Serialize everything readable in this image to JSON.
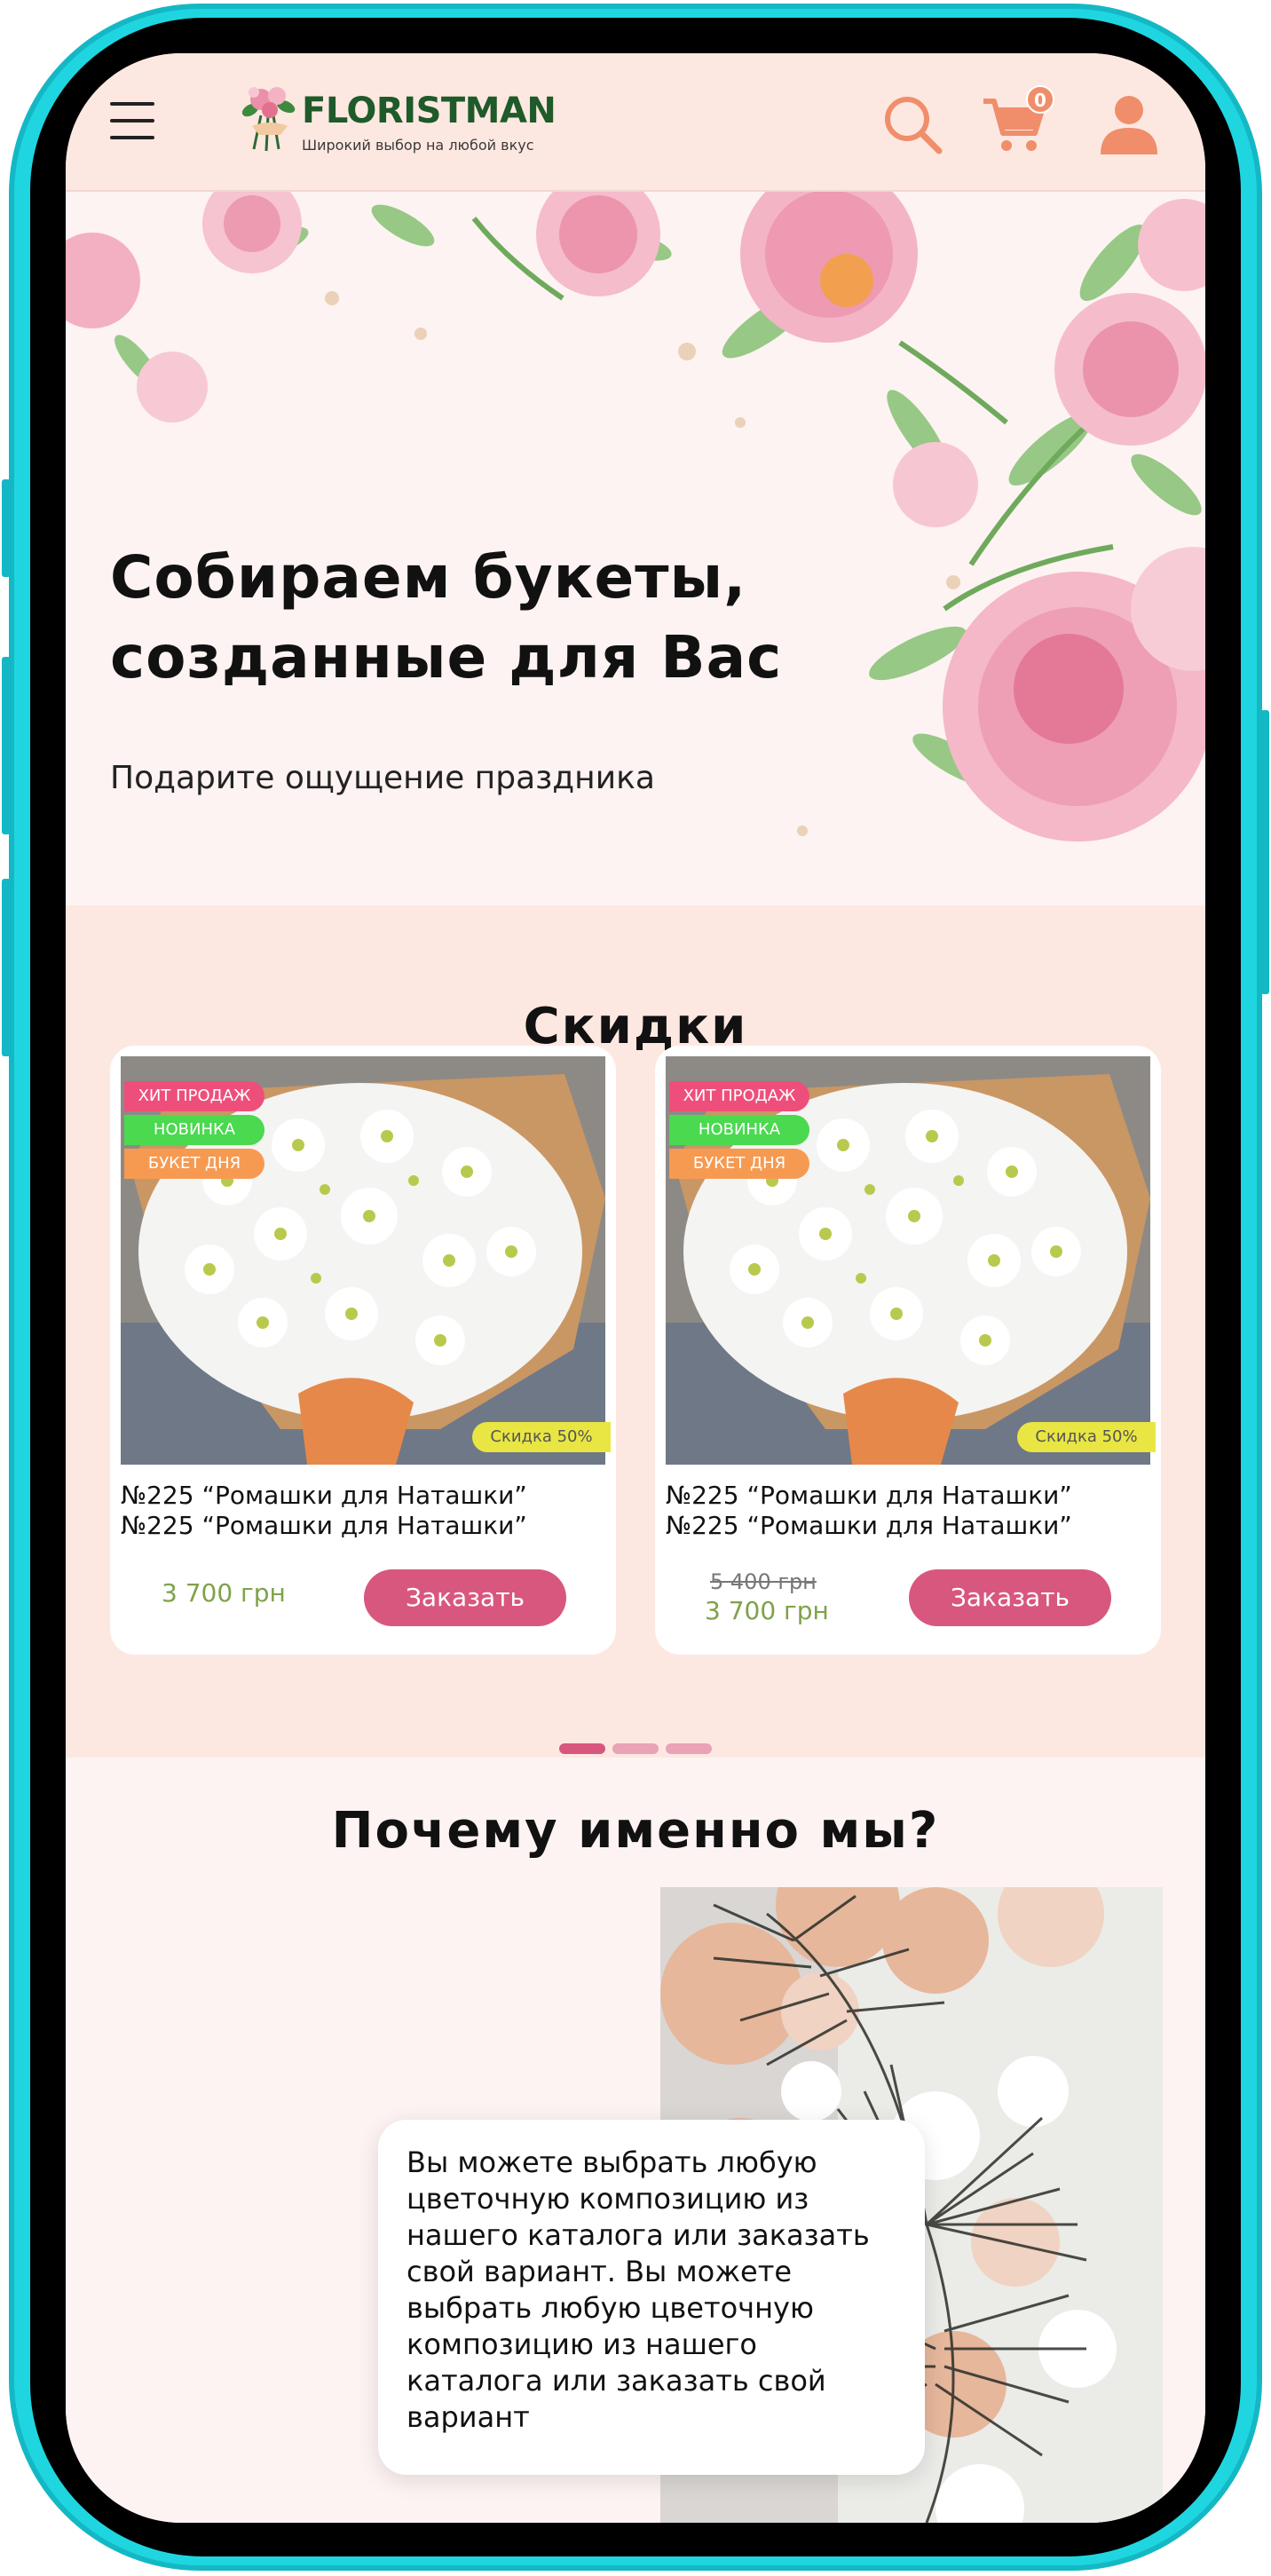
{
  "header": {
    "logo_name": "FLORISTMAN",
    "logo_tagline": "Широкий выбор на любой вкус",
    "cart_count": "0"
  },
  "hero": {
    "title_line1": "Собираем букеты,",
    "title_line2": "созданные для Вас",
    "subtitle": "Подарите ощущение праздника"
  },
  "sale": {
    "title": "Скидки",
    "cards": [
      {
        "badges": [
          "ХИТ ПРОДАЖ",
          "НОВИНКА",
          "БУКЕТ ДНЯ"
        ],
        "discount": "Скидка 50%",
        "name": "№225 “Ромашки для Наташки” №225 “Ромашки для Наташки”",
        "price": "3 700 грн",
        "button": "Заказать"
      },
      {
        "badges": [
          "ХИТ ПРОДАЖ",
          "НОВИНКА",
          "БУКЕТ ДНЯ"
        ],
        "discount": "Скидка 50%",
        "name": "№225 “Ромашки для Наташки” №225 “Ромашки для Наташки”",
        "old_price": "5 400 грн",
        "price": "3 700 грн",
        "button": "Заказать"
      }
    ],
    "active_slide": 1,
    "slide_count": 3
  },
  "why": {
    "title": "Почему именно мы?",
    "text": "Вы можете выбрать любую цветочную композицию из нашего каталога или заказать свой вариант. Вы можете выбрать любую цветочную композицию из нашего каталога или заказать свой вариант"
  },
  "colors": {
    "accent": "#d8577f",
    "price_green": "#7fa24a",
    "header_bg": "#fde8e1",
    "frame": "#1fd6e0"
  }
}
